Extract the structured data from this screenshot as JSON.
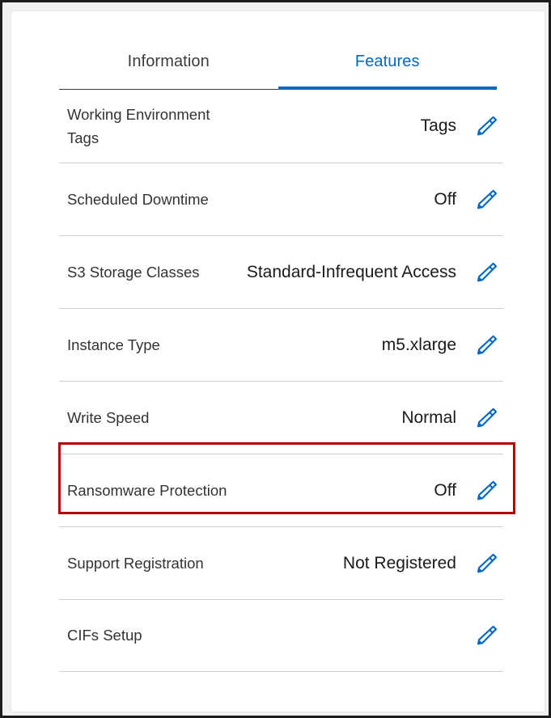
{
  "panel": {
    "accent_color": "#0067c5",
    "label_color": "#333333",
    "value_color": "#1a1a1a",
    "divider_color": "#cfcfcf",
    "highlight_color": "#b00000",
    "frame_color": "#1d1d1d"
  },
  "tabs": [
    {
      "label": "Information",
      "active": false
    },
    {
      "label": "Features",
      "active": true
    }
  ],
  "features": [
    {
      "label": "Working Environment Tags",
      "value": "Tags",
      "edit_icon": "pencil-icon"
    },
    {
      "label": "Scheduled Downtime",
      "value": "Off",
      "edit_icon": "pencil-icon"
    },
    {
      "label": "S3 Storage Classes",
      "value": "Standard-Infrequent Access",
      "edit_icon": "pencil-icon"
    },
    {
      "label": "Instance Type",
      "value": "m5.xlarge",
      "edit_icon": "pencil-icon"
    },
    {
      "label": "Write Speed",
      "value": "Normal",
      "edit_icon": "pencil-icon"
    },
    {
      "label": "Ransomware Protection",
      "value": "Off",
      "edit_icon": "pencil-icon",
      "highlighted": true
    },
    {
      "label": "Support Registration",
      "value": "Not Registered",
      "edit_icon": "pencil-icon"
    },
    {
      "label": "CIFs Setup",
      "value": "",
      "edit_icon": "pencil-icon"
    }
  ]
}
